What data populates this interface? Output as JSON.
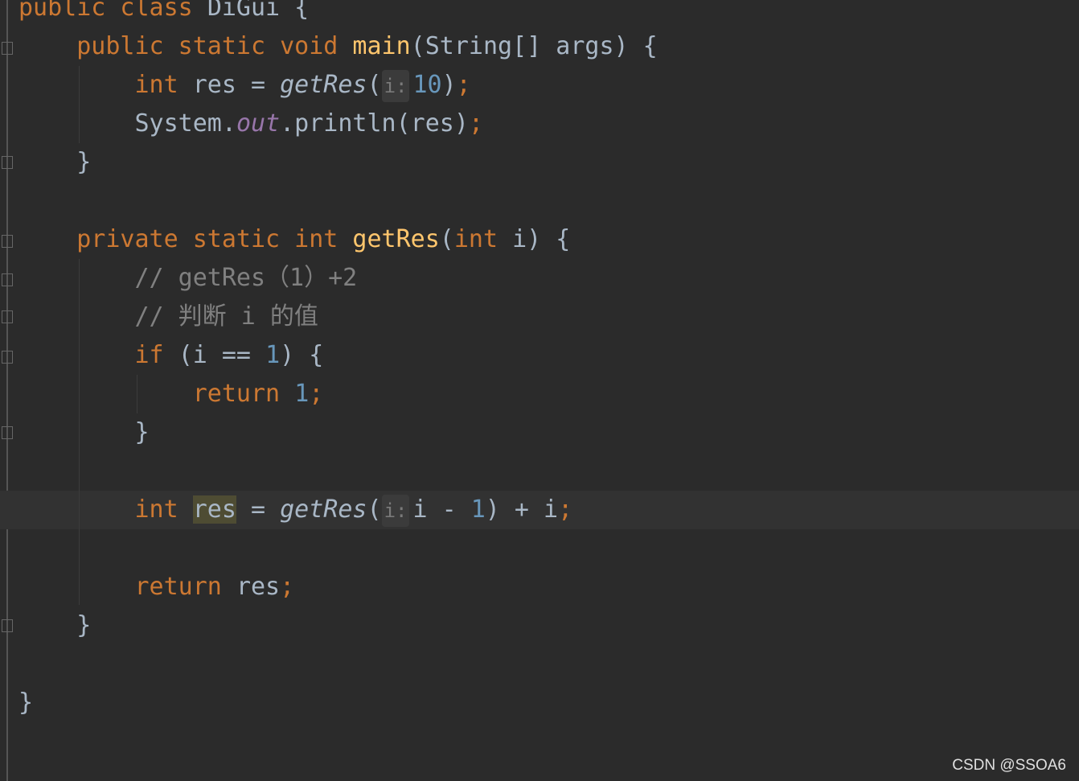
{
  "editor": {
    "lines": [
      [
        [
          "public class ",
          "kw"
        ],
        [
          "DiGui {",
          ""
        ]
      ],
      [
        [
          "    ",
          ""
        ],
        [
          "public static void ",
          "kw"
        ],
        [
          "main",
          "fn"
        ],
        [
          "(String[] args) {",
          ""
        ]
      ],
      [
        [
          "        ",
          ""
        ],
        [
          "int ",
          "kw"
        ],
        [
          "res = ",
          ""
        ],
        [
          "getRes",
          "it"
        ],
        [
          "(",
          ""
        ],
        [
          "i:",
          "hint"
        ],
        [
          "10",
          "num"
        ],
        [
          ")",
          ""
        ],
        [
          ";",
          "semi"
        ]
      ],
      [
        [
          "        ",
          ""
        ],
        [
          "System.",
          ""
        ],
        [
          "out",
          "fld"
        ],
        [
          ".println(res)",
          ""
        ],
        [
          ";",
          "semi"
        ]
      ],
      [
        [
          "    }",
          ""
        ]
      ],
      [],
      [
        [
          "    ",
          ""
        ],
        [
          "private static int ",
          "kw"
        ],
        [
          "getRes",
          "fn"
        ],
        [
          "(",
          ""
        ],
        [
          "int ",
          "kw"
        ],
        [
          "i) {",
          ""
        ]
      ],
      [
        [
          "        ",
          ""
        ],
        [
          "// getRes（1）+2",
          "cm"
        ]
      ],
      [
        [
          "        ",
          ""
        ],
        [
          "// 判断 i 的值",
          "cm"
        ]
      ],
      [
        [
          "        ",
          ""
        ],
        [
          "if ",
          "kw"
        ],
        [
          "(i == ",
          ""
        ],
        [
          "1",
          "num"
        ],
        [
          ") {",
          ""
        ]
      ],
      [
        [
          "            ",
          ""
        ],
        [
          "return ",
          "kw"
        ],
        [
          "1",
          "num"
        ],
        [
          ";",
          "semi"
        ]
      ],
      [
        [
          "        }",
          ""
        ]
      ],
      [],
      [
        [
          "        ",
          ""
        ],
        [
          "int ",
          "kw"
        ],
        [
          "res",
          "hl"
        ],
        [
          " = ",
          ""
        ],
        [
          "getRes",
          "it"
        ],
        [
          "(",
          ""
        ],
        [
          "i:",
          "hint"
        ],
        [
          "i - ",
          ""
        ],
        [
          "1",
          "num"
        ],
        [
          ") + i",
          ""
        ],
        [
          ";",
          "semi"
        ]
      ],
      [],
      [
        [
          "        ",
          ""
        ],
        [
          "return ",
          "kw"
        ],
        [
          "res",
          ""
        ],
        [
          ";",
          "semi"
        ]
      ],
      [
        [
          "    }",
          ""
        ]
      ],
      [],
      [
        [
          "}",
          ""
        ]
      ]
    ],
    "current_line": 13
  },
  "watermark": "CSDN @SSOA6"
}
